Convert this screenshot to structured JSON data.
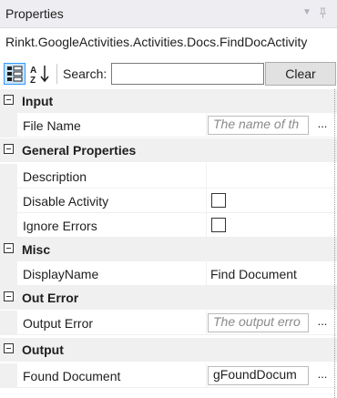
{
  "panel": {
    "title": "Properties"
  },
  "object_name": "Rinkt.GoogleActivities.Activities.Docs.FindDocActivity",
  "toolbar": {
    "search_label": "Search:",
    "search_value": "",
    "clear_label": "Clear"
  },
  "categories": [
    {
      "label": "Input",
      "props": [
        {
          "name": "File Name",
          "placeholder": "The name of th"
        }
      ]
    },
    {
      "label": "General Properties",
      "props": [
        {
          "name": "Description"
        },
        {
          "name": "Disable Activity"
        },
        {
          "name": "Ignore Errors"
        }
      ]
    },
    {
      "label": "Misc",
      "props": [
        {
          "name": "DisplayName",
          "value": "Find Document"
        }
      ]
    },
    {
      "label": "Out Error",
      "props": [
        {
          "name": "Output Error",
          "placeholder": "The output erro"
        }
      ]
    },
    {
      "label": "Output",
      "props": [
        {
          "name": "Found Document",
          "value": "gFoundDocum"
        }
      ]
    }
  ],
  "ellipsis": "...",
  "icons": {
    "categorized": "categorized-view-icon",
    "alphabetical": "sort-az-icon",
    "pin": "pin-icon",
    "dropdown": "dropdown-arrow-icon"
  }
}
